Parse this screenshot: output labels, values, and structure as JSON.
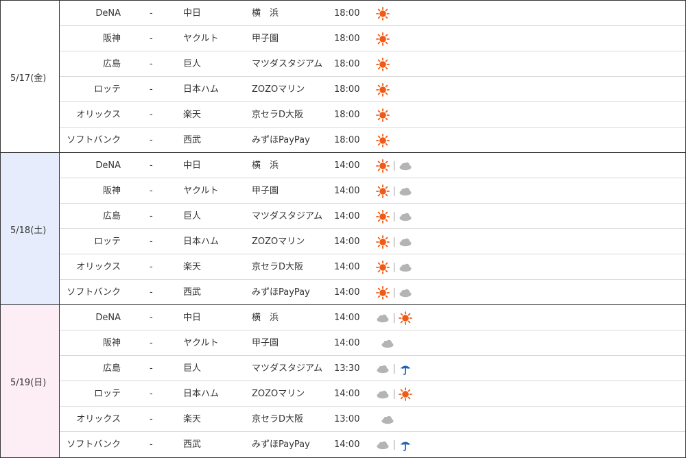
{
  "days": [
    {
      "date": "5/17(金)",
      "bg": "#ffffff",
      "games": [
        {
          "home": "DeNA",
          "sep": "-",
          "away": "中日",
          "venue": "横　浜",
          "time": "18:00",
          "weather": [
            "sunny"
          ]
        },
        {
          "home": "阪神",
          "sep": "-",
          "away": "ヤクルト",
          "venue": "甲子園",
          "time": "18:00",
          "weather": [
            "sunny"
          ]
        },
        {
          "home": "広島",
          "sep": "-",
          "away": "巨人",
          "venue": "マツダスタジアム",
          "time": "18:00",
          "weather": [
            "sunny"
          ]
        },
        {
          "home": "ロッテ",
          "sep": "-",
          "away": "日本ハム",
          "venue": "ZOZOマリン",
          "time": "18:00",
          "weather": [
            "sunny"
          ]
        },
        {
          "home": "オリックス",
          "sep": "-",
          "away": "楽天",
          "venue": "京セラD大阪",
          "time": "18:00",
          "weather": [
            "sunny"
          ]
        },
        {
          "home": "ソフトバンク",
          "sep": "-",
          "away": "西武",
          "venue": "みずほPayPay",
          "time": "18:00",
          "weather": [
            "sunny"
          ]
        }
      ]
    },
    {
      "date": "5/18(土)",
      "bg": "#e6ecfc",
      "games": [
        {
          "home": "DeNA",
          "sep": "-",
          "away": "中日",
          "venue": "横　浜",
          "time": "14:00",
          "weather": [
            "sunny",
            "cloudy"
          ]
        },
        {
          "home": "阪神",
          "sep": "-",
          "away": "ヤクルト",
          "venue": "甲子園",
          "time": "14:00",
          "weather": [
            "sunny",
            "cloudy"
          ]
        },
        {
          "home": "広島",
          "sep": "-",
          "away": "巨人",
          "venue": "マツダスタジアム",
          "time": "14:00",
          "weather": [
            "sunny",
            "cloudy"
          ]
        },
        {
          "home": "ロッテ",
          "sep": "-",
          "away": "日本ハム",
          "venue": "ZOZOマリン",
          "time": "14:00",
          "weather": [
            "sunny",
            "cloudy"
          ]
        },
        {
          "home": "オリックス",
          "sep": "-",
          "away": "楽天",
          "venue": "京セラD大阪",
          "time": "14:00",
          "weather": [
            "sunny",
            "cloudy"
          ]
        },
        {
          "home": "ソフトバンク",
          "sep": "-",
          "away": "西武",
          "venue": "みずほPayPay",
          "time": "14:00",
          "weather": [
            "sunny",
            "cloudy"
          ]
        }
      ]
    },
    {
      "date": "5/19(日)",
      "bg": "#fdeef5",
      "games": [
        {
          "home": "DeNA",
          "sep": "-",
          "away": "中日",
          "venue": "横　浜",
          "time": "14:00",
          "weather": [
            "cloudy",
            "sunny"
          ]
        },
        {
          "home": "阪神",
          "sep": "-",
          "away": "ヤクルト",
          "venue": "甲子園",
          "time": "14:00",
          "weather": [
            "cloudy"
          ]
        },
        {
          "home": "広島",
          "sep": "-",
          "away": "巨人",
          "venue": "マツダスタジアム",
          "time": "13:30",
          "weather": [
            "cloudy",
            "rain"
          ]
        },
        {
          "home": "ロッテ",
          "sep": "-",
          "away": "日本ハム",
          "venue": "ZOZOマリン",
          "time": "14:00",
          "weather": [
            "cloudy",
            "sunny"
          ]
        },
        {
          "home": "オリックス",
          "sep": "-",
          "away": "楽天",
          "venue": "京セラD大阪",
          "time": "13:00",
          "weather": [
            "cloudy"
          ]
        },
        {
          "home": "ソフトバンク",
          "sep": "-",
          "away": "西武",
          "venue": "みずほPayPay",
          "time": "14:00",
          "weather": [
            "cloudy",
            "rain"
          ]
        }
      ]
    }
  ],
  "colors": {
    "sun": "#f05a14",
    "cloud": "#b4b4b4",
    "rain": "#1e64b4",
    "border": "#333333",
    "row_sep": "#d8d8d8"
  }
}
